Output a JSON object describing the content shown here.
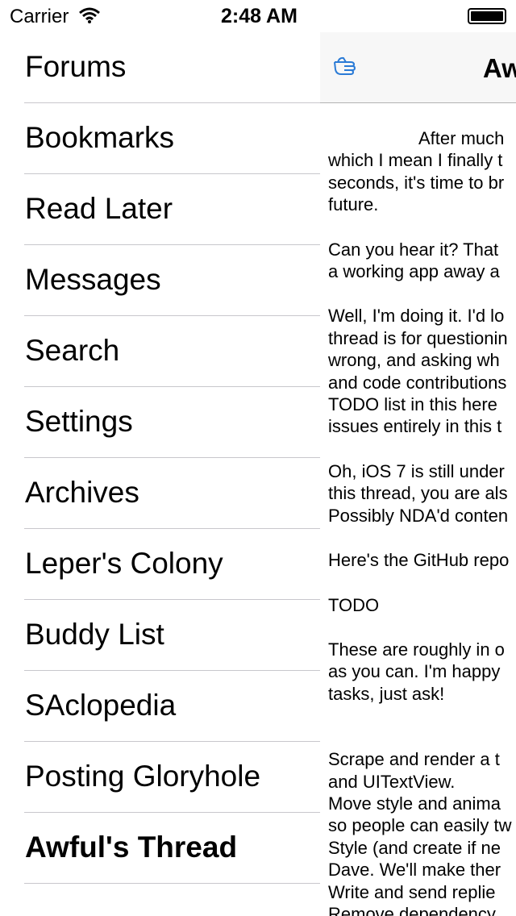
{
  "status_bar": {
    "carrier": "Carrier",
    "time": "2:48 AM"
  },
  "menu": {
    "items": [
      {
        "label": "Forums"
      },
      {
        "label": "Bookmarks"
      },
      {
        "label": "Read Later"
      },
      {
        "label": "Messages"
      },
      {
        "label": "Search"
      },
      {
        "label": "Settings"
      },
      {
        "label": "Archives"
      },
      {
        "label": "Leper's Colony"
      },
      {
        "label": "Buddy List"
      },
      {
        "label": "SAclopedia"
      },
      {
        "label": "Posting Gloryhole"
      },
      {
        "label": "Awful's Thread"
      }
    ],
    "selected": "Awful's Thread"
  },
  "thread_view": {
    "nav_icon": "pointing-hand-icon",
    "title": "Aw",
    "post": {
      "p1": [
        "After much",
        "which I mean I finally t",
        "seconds, it's time to br",
        "future."
      ],
      "p2": [
        "Can you hear it? That",
        "a working app away a"
      ],
      "p3": [
        "Well, I'm doing it. I'd lo",
        "thread is for questionin",
        "wrong, and asking wh",
        "and code contributions",
        "TODO list in this here",
        "issues entirely in this t"
      ],
      "p4": [
        "Oh, iOS 7 is still under",
        "this thread, you are als",
        "Possibly NDA'd conten"
      ],
      "p5": [
        "Here's the GitHub repo"
      ],
      "p6": [
        "TODO"
      ],
      "p7": [
        "These are roughly in o",
        "as you can. I'm happy",
        "tasks, just ask!"
      ],
      "list": [
        " Scrape and render a t",
        "and UITextView.",
        " Move style and anima",
        "so people can easily tw",
        " Style (and create if ne",
        "Dave. We'll make ther",
        " Write and send replie",
        " Remove dependency"
      ]
    }
  }
}
